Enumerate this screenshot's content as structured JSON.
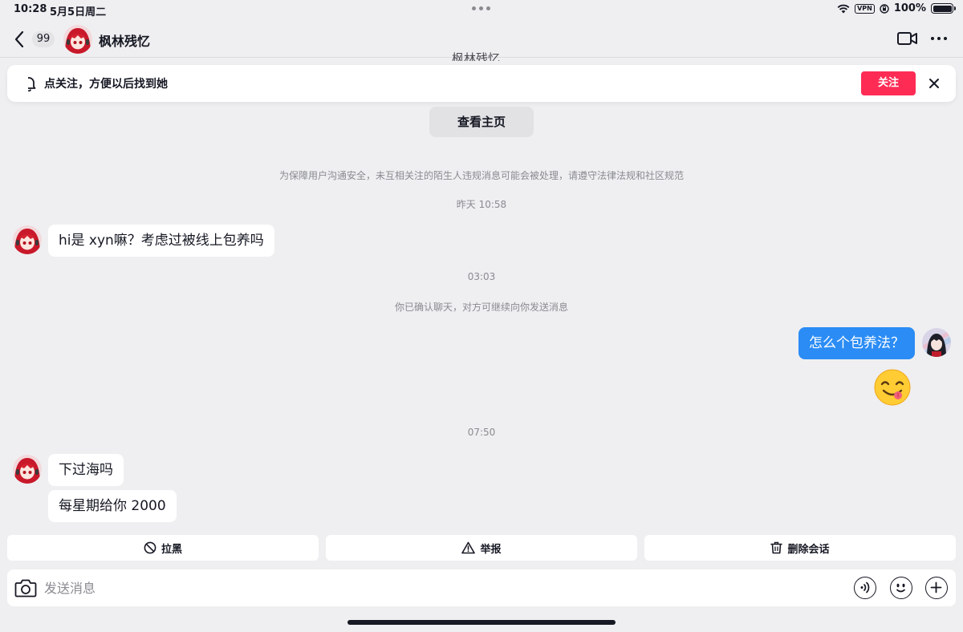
{
  "status_bar": {
    "time": "10:28",
    "date": "5月5日周二",
    "vpn": "VPN",
    "battery": "100%"
  },
  "header": {
    "unread_count": "99",
    "contact_name": "枫林残忆"
  },
  "follow_banner": {
    "text": "点关注，方便以后找到她",
    "button": "关注"
  },
  "view_homepage": "查看主页",
  "security_notice": "为保障用户沟通安全，未互相关注的陌生人违规消息可能会被处理，请遵守法律法规和社区规范",
  "messages": {
    "ts1": "昨天 10:58",
    "msg1": "hi是 xyn嘛？考虑过被线上包养吗",
    "ts2": "03:03",
    "confirm_notice": "你已确认聊天，对方可继续向你发送消息",
    "msg2": "怎么个包养法？",
    "ts3": "07:50",
    "msg3": "下过海吗",
    "msg4": "每星期给你 2000"
  },
  "actions": {
    "block": "拉黑",
    "report": "举报",
    "delete": "删除会话"
  },
  "composer": {
    "placeholder": "发送消息"
  },
  "colors": {
    "accent_red": "#fe2c55",
    "bubble_blue": "#2b8cf5",
    "background": "#efeff1"
  }
}
